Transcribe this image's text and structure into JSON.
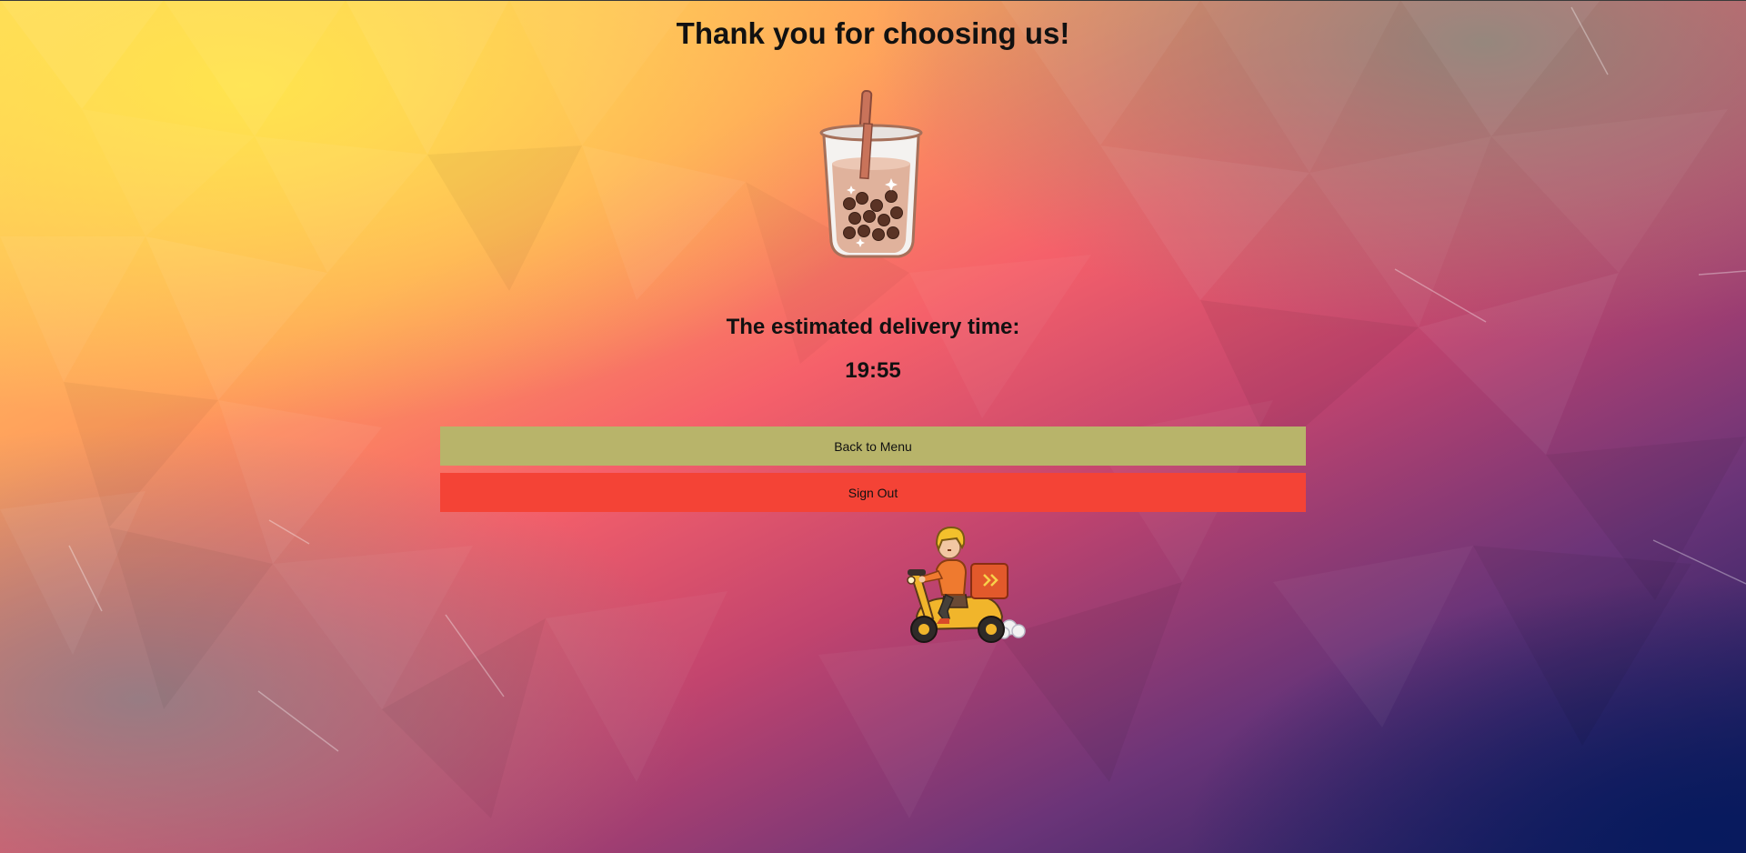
{
  "page": {
    "title": "Thank you for choosing us!",
    "eta_label": "The estimated delivery time:",
    "eta_value": "19:55"
  },
  "buttons": {
    "back_to_menu": "Back to Menu",
    "sign_out": "Sign Out"
  },
  "illustrations": {
    "drink": "bubble-tea-icon",
    "courier": "delivery-scooter-icon"
  },
  "colors": {
    "back_to_menu_bg": "#b8b46a",
    "sign_out_bg": "#f44336",
    "text": "#111111"
  }
}
